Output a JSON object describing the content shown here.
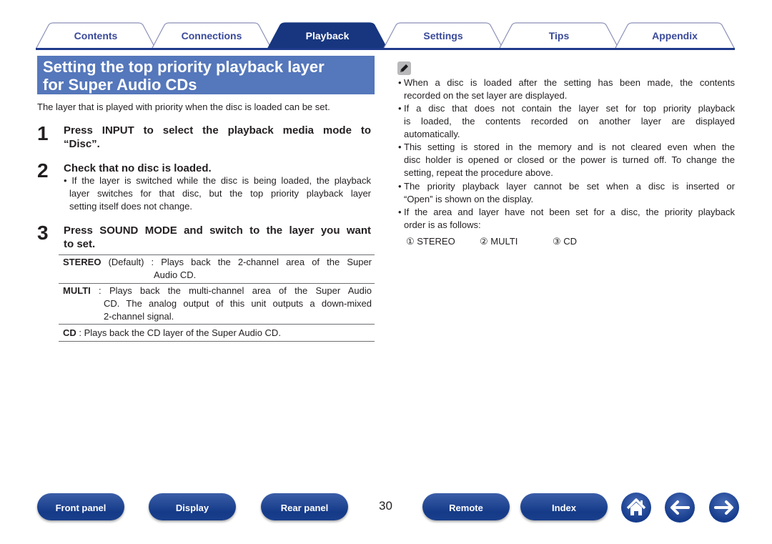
{
  "tabs": [
    {
      "label": "Contents",
      "active": false
    },
    {
      "label": "Connections",
      "active": false
    },
    {
      "label": "Playback",
      "active": true
    },
    {
      "label": "Settings",
      "active": false
    },
    {
      "label": "Tips",
      "active": false
    },
    {
      "label": "Appendix",
      "active": false
    }
  ],
  "title": {
    "line1": "Setting the top priority playback layer",
    "line2": "for Super Audio CDs"
  },
  "intro": "The layer that is played with priority when the disc is loaded can be set.",
  "steps": [
    {
      "num": "1",
      "line1": "Press INPUT to select the playback media mode to",
      "line2": "“Disc”."
    },
    {
      "num": "2",
      "line1": "Check that no disc is loaded.",
      "bullet_lines": [
        "• If the layer is switched while the disc is being loaded, the playback",
        "layer switches for that disc, but the top priority playback layer",
        "setting itself does not change."
      ]
    },
    {
      "num": "3",
      "line1": "Press SOUND MODE and switch to the layer you want",
      "line2": "to set."
    }
  ],
  "options": [
    {
      "term": "STEREO",
      "qualifier": " (Default) : ",
      "lines": [
        "Plays back the 2-channel area of the Super",
        "Audio CD."
      ]
    },
    {
      "term": "MULTI",
      "qualifier": " : ",
      "lines": [
        "Plays back the multi-channel area of the Super Audio",
        "CD. The analog output of this unit outputs a down-mixed",
        "2-channel signal."
      ]
    },
    {
      "term": "CD",
      "qualifier": " : ",
      "lines": [
        "Plays back the CD layer of the Super Audio CD."
      ]
    }
  ],
  "notes": [
    [
      "When a disc is loaded after the setting has been made, the contents",
      "recorded on the set layer are displayed."
    ],
    [
      "If a disc that does not contain the layer set for top priority playback",
      "is loaded, the contents recorded on another layer are displayed",
      "automatically."
    ],
    [
      "This setting is stored in the memory and is not cleared even when the",
      "disc holder is opened or closed or the power is turned off. To change the",
      "setting, repeat the procedure above."
    ],
    [
      "The priority playback layer cannot be set when a disc is inserted or",
      "“Open” is shown on the display."
    ],
    [
      "If the area and layer have not been set for a disc, the priority playback",
      "order is as follows:"
    ]
  ],
  "priority_order": [
    "① STEREO",
    "② MULTI",
    "③ CD"
  ],
  "page_number": "30",
  "bottom_nav": {
    "front_panel": "Front panel",
    "display": "Display",
    "rear_panel": "Rear panel",
    "remote": "Remote",
    "index": "Index"
  },
  "icons": {
    "note": "pencil-icon",
    "home": "home-icon",
    "back": "arrow-left-icon",
    "forward": "arrow-right-icon"
  },
  "colors": {
    "accent": "#1f3a8a",
    "title_bg": "#5577bb",
    "tab_text": "#3a4a9a"
  }
}
